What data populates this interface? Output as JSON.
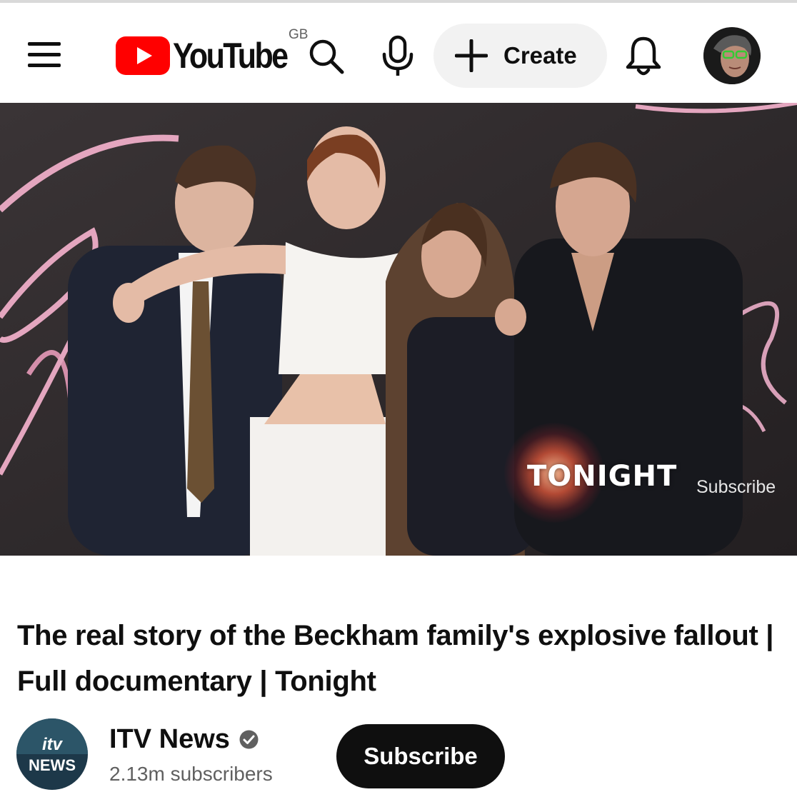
{
  "header": {
    "logo_text": "YouTube",
    "region": "GB",
    "create_label": "Create",
    "icons": {
      "menu": "hamburger-menu-icon",
      "search": "search-icon",
      "mic": "microphone-icon",
      "create": "plus-icon",
      "notifications": "bell-icon"
    }
  },
  "video": {
    "overlay_brand": "TONIGHT",
    "overlay_subscribe": "Subscribe"
  },
  "title": "The real story of the Beckham family's explosive fallout | Full documentary | Tonight",
  "channel": {
    "logo_brand": "itv",
    "logo_word": "NEWS",
    "name": "ITV News",
    "subscribers": "2.13m subscribers",
    "subscribe_label": "Subscribe"
  },
  "colors": {
    "youtube_red": "#FF0000",
    "text_primary": "#0f0f0f",
    "text_secondary": "#606060",
    "create_bg": "#f2f2f2",
    "subscribe_bg": "#0f0f0f"
  }
}
